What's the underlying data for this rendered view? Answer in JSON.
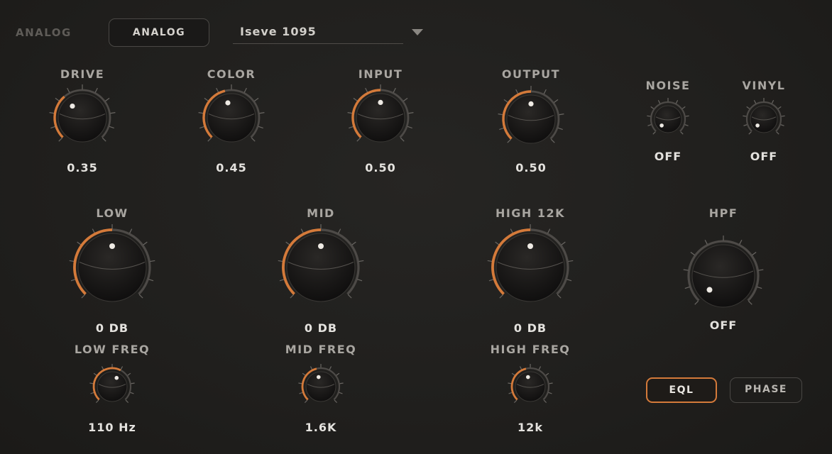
{
  "header": {
    "mode_label": "ANALOG",
    "mode_button": "ANALOG",
    "preset_name": "Iseve 1095"
  },
  "knobs": {
    "drive": {
      "label": "DRIVE",
      "value": "0.35",
      "level": 0.35
    },
    "color": {
      "label": "COLOR",
      "value": "0.45",
      "level": 0.45
    },
    "input": {
      "label": "INPUT",
      "value": "0.50",
      "level": 0.5
    },
    "output": {
      "label": "OUTPUT",
      "value": "0.50",
      "level": 0.5
    },
    "noise": {
      "label": "NOISE",
      "value": "OFF",
      "level": 0
    },
    "vinyl": {
      "label": "VINYL",
      "value": "OFF",
      "level": 0
    },
    "low": {
      "label": "LOW",
      "value": "0 DB",
      "level": 0.5
    },
    "mid": {
      "label": "MID",
      "value": "0 DB",
      "level": 0.5
    },
    "high": {
      "label": "HIGH 12K",
      "value": "0 DB",
      "level": 0.5
    },
    "hpf": {
      "label": "HPF",
      "value": "OFF",
      "level": 0
    },
    "low_freq": {
      "label": "LOW FREQ",
      "value": "110 Hz",
      "level": 0.6
    },
    "mid_freq": {
      "label": "MID FREQ",
      "value": "1.6K",
      "level": 0.45
    },
    "high_freq": {
      "label": "HIGH FREQ",
      "value": "12k",
      "level": 0.45
    }
  },
  "buttons": {
    "eql": "EQL",
    "phase": "PHASE",
    "eql_active": true
  },
  "colors": {
    "accent": "#d47a3a",
    "panel": "#201f1d",
    "knob_body": "#121111",
    "text": "#e4e2de",
    "label": "#a9a6a1"
  }
}
